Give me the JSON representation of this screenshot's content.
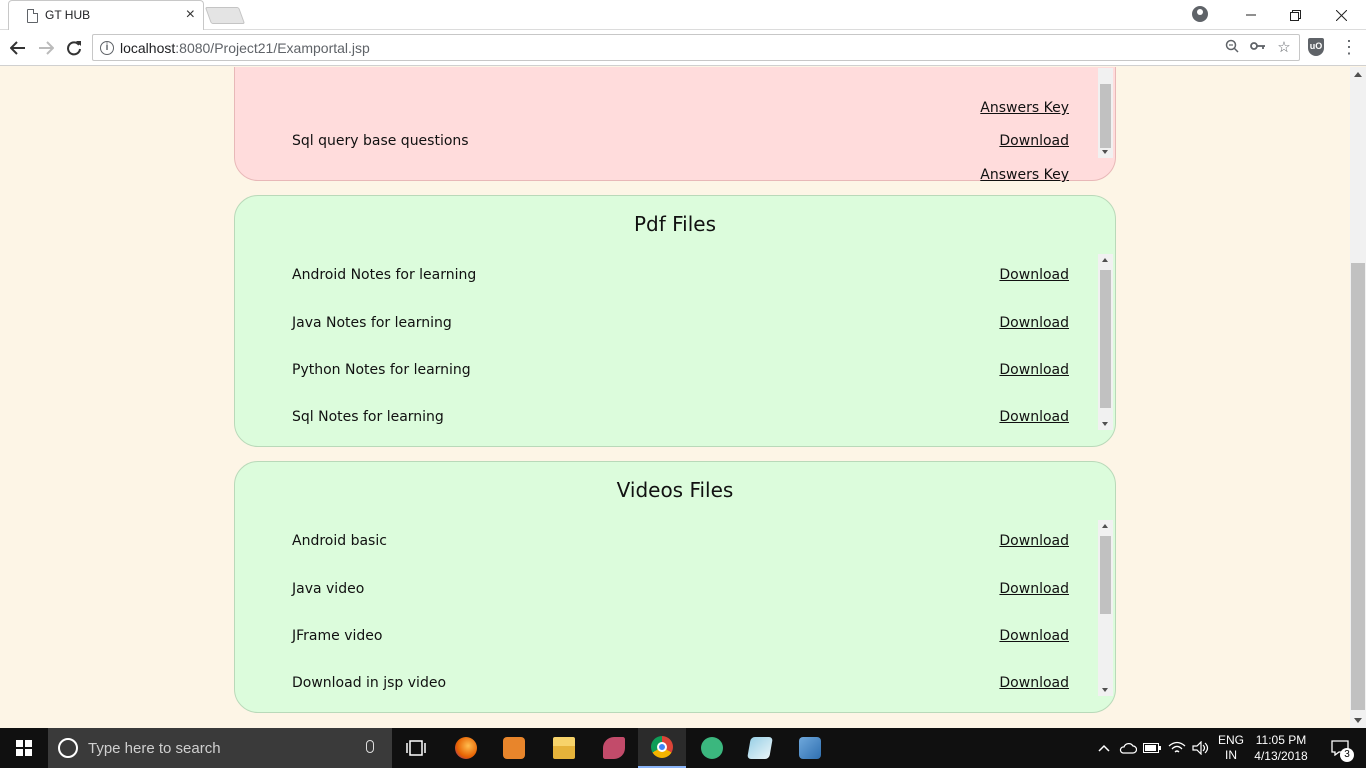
{
  "browser": {
    "tab_title": "GT HUB",
    "tab_close": "×",
    "url_host": "localhost",
    "url_rest": ":8080/Project21/Examportal.jsp"
  },
  "sections": {
    "top": {
      "rows": [
        {
          "label": "",
          "link": "Answers Key"
        },
        {
          "label": "Sql query base questions",
          "link": "Download"
        },
        {
          "label": "",
          "link": "Answers Key"
        }
      ]
    },
    "pdf": {
      "title": "Pdf Files",
      "rows": [
        {
          "label": "Android Notes for learning",
          "link": "Download"
        },
        {
          "label": "Java Notes for learning",
          "link": "Download"
        },
        {
          "label": "Python Notes for learning",
          "link": "Download"
        },
        {
          "label": "Sql Notes for learning",
          "link": "Download"
        }
      ]
    },
    "videos": {
      "title": "Videos Files",
      "rows": [
        {
          "label": "Android basic",
          "link": "Download"
        },
        {
          "label": "Java video",
          "link": "Download"
        },
        {
          "label": "JFrame video",
          "link": "Download"
        },
        {
          "label": "Download in jsp video",
          "link": "Download"
        }
      ]
    }
  },
  "taskbar": {
    "search_placeholder": "Type here to search",
    "lang_top": "ENG",
    "lang_bottom": "IN",
    "time": "11:05 PM",
    "date": "4/13/2018",
    "notification_count": "3"
  },
  "colors": {
    "page_bg": "#fdf5e6",
    "red_section": "#ffdcdc",
    "green_section": "#dcfcdc"
  }
}
